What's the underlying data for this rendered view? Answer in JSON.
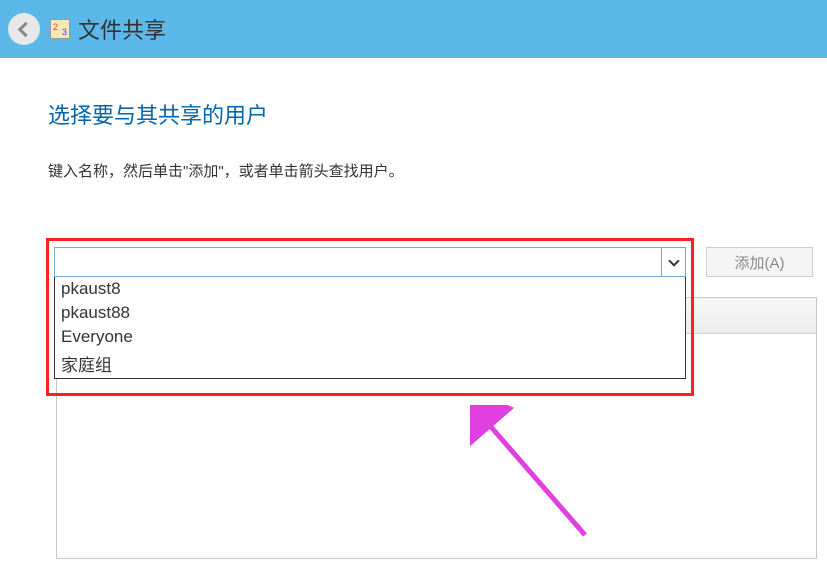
{
  "titlebar": {
    "title": "文件共享"
  },
  "heading": "选择要与其共享的用户",
  "instruction": "键入名称，然后单击\"添加\"，或者单击箭头查找用户。",
  "combo": {
    "value": "",
    "placeholder": ""
  },
  "add_button_label": "添加(A)",
  "dropdown_items": [
    "pkaust8",
    "pkaust88",
    "Everyone",
    "家庭组"
  ]
}
